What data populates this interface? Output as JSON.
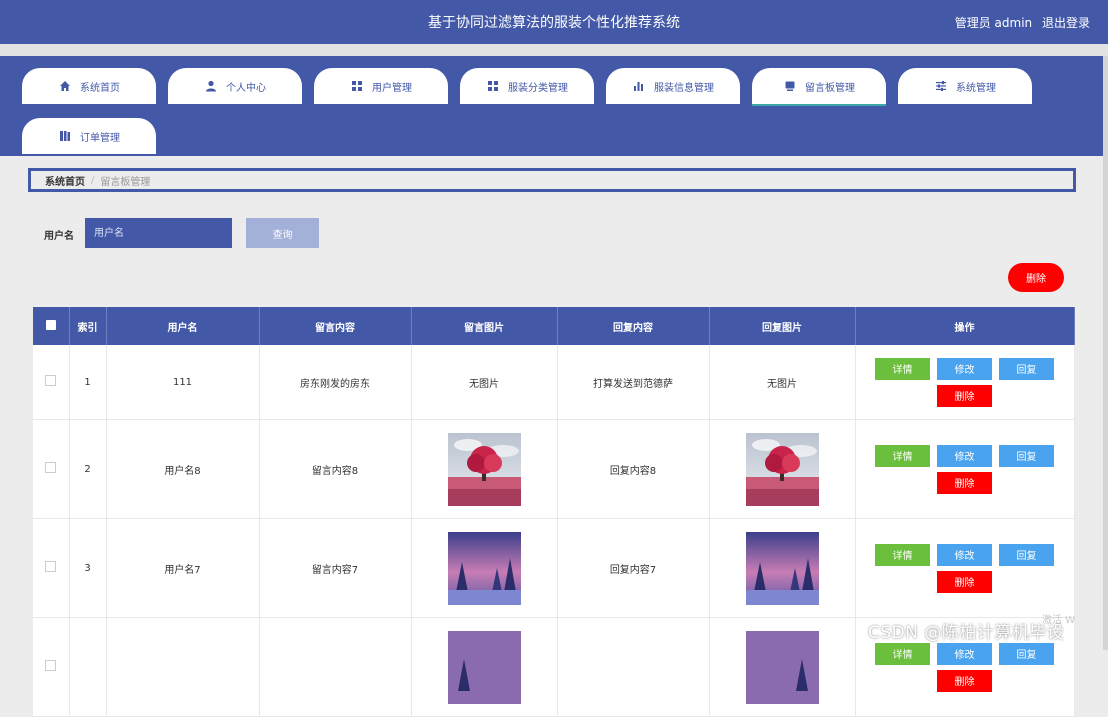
{
  "header": {
    "title": "基于协同过滤算法的服装个性化推荐系统",
    "admin_label": "管理员 admin",
    "logout_label": "退出登录"
  },
  "nav": {
    "tabs": [
      {
        "label": "系统首页",
        "icon": "home-icon"
      },
      {
        "label": "个人中心",
        "icon": "person-icon"
      },
      {
        "label": "用户管理",
        "icon": "grid-icon"
      },
      {
        "label": "服装分类管理",
        "icon": "grid-icon"
      },
      {
        "label": "服装信息管理",
        "icon": "bar-chart-icon"
      },
      {
        "label": "留言板管理",
        "icon": "message-icon"
      },
      {
        "label": "系统管理",
        "icon": "sliders-icon"
      },
      {
        "label": "订单管理",
        "icon": "book-icon"
      }
    ]
  },
  "breadcrumb": {
    "home": "系统首页",
    "separator": "/",
    "current": "留言板管理"
  },
  "search": {
    "label": "用户名",
    "placeholder": "用户名",
    "query_button": "查询"
  },
  "actions": {
    "delete_label": "删除"
  },
  "table": {
    "headers": [
      "索引",
      "用户名",
      "留言内容",
      "留言图片",
      "回复内容",
      "回复图片",
      "操作"
    ],
    "rows": [
      {
        "index": "1",
        "username": "111",
        "content": "房东刚发的房东",
        "image": "无图片",
        "reply": "打算发送到范德萨",
        "reply_image": "无图片"
      },
      {
        "index": "2",
        "username": "用户名8",
        "content": "留言内容8",
        "image": "",
        "reply": "回复内容8",
        "reply_image": ""
      },
      {
        "index": "3",
        "username": "用户名7",
        "content": "留言内容7",
        "image": "",
        "reply": "回复内容7",
        "reply_image": ""
      },
      {
        "index": "",
        "username": "",
        "content": "",
        "image": "",
        "reply": "",
        "reply_image": ""
      }
    ],
    "op_labels": {
      "detail": "详情",
      "edit": "修改",
      "reply": "回复",
      "delete": "删除"
    }
  },
  "watermark": {
    "text": "CSDN @陈柏计算机毕设",
    "activate": "激活 W"
  },
  "colors": {
    "primary": "#4359a8",
    "danger": "#ff0000",
    "success": "#6bbf3c",
    "info": "#4aa3ee"
  }
}
